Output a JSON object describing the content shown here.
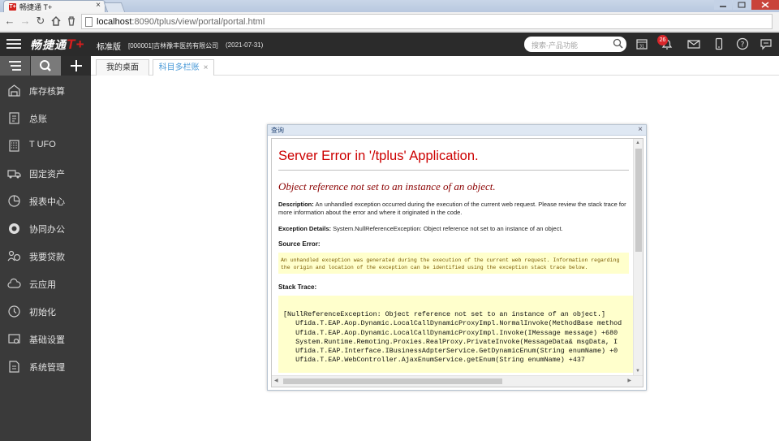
{
  "browser": {
    "tab_title": "畅捷通 T+",
    "tab_favicon": "T+",
    "url_host": "localhost",
    "url_rest": ":8090/tplus/view/portal/portal.html"
  },
  "header": {
    "logo_text": "畅捷通",
    "logo_mark": "T+",
    "edition": "标准版",
    "company": "[000001]吉林豫丰医药有限公司",
    "period": "(2021-07-31)",
    "search_placeholder": "搜索-产品功能",
    "notification_count": "26",
    "accent_color": "#d81e1e"
  },
  "sidebar": {
    "items": [
      {
        "label": "库存核算",
        "icon": "warehouse-icon"
      },
      {
        "label": "总账",
        "icon": "ledger-icon"
      },
      {
        "label": "T UFO",
        "icon": "report-sheet-icon"
      },
      {
        "label": "固定资产",
        "icon": "truck-icon"
      },
      {
        "label": "报表中心",
        "icon": "pie-chart-icon"
      },
      {
        "label": "协同办公",
        "icon": "collaboration-icon"
      },
      {
        "label": "我要贷款",
        "icon": "loan-icon"
      },
      {
        "label": "云应用",
        "icon": "cloud-icon"
      },
      {
        "label": "初始化",
        "icon": "clock-icon"
      },
      {
        "label": "基础设置",
        "icon": "settings-icon"
      },
      {
        "label": "系统管理",
        "icon": "system-doc-icon"
      }
    ]
  },
  "tabs": [
    {
      "label": "我的桌面"
    },
    {
      "label": "科目多栏账",
      "close": "×"
    }
  ],
  "dialog": {
    "title": "查询",
    "close": "×",
    "error_title": "Server Error in '/tplus' Application.",
    "error_subtitle": "Object reference not set to an instance of an object.",
    "description_label": "Description:",
    "description_text": "An unhandled exception occurred during the execution of the current web request. Please review the stack trace for more information about the error and where it originated in the code.",
    "exception_label": "Exception Details:",
    "exception_text": "System.NullReferenceException: Object reference not set to an instance of an object.",
    "source_label": "Source Error:",
    "source_lines": [
      "An unhandled exception was generated during the execution of the current web request. Information regarding",
      "the origin and location of the exception can be identified using the exception stack trace below."
    ],
    "stack_label": "Stack Trace:",
    "stack_lines": [
      "[NullReferenceException: Object reference not set to an instance of an object.]",
      "   Ufida.T.EAP.Aop.Dynamic.LocalCallDynamicProxyImpl.NormalInvoke(MethodBase method",
      "   Ufida.T.EAP.Aop.Dynamic.LocalCallDynamicProxyImpl.Invoke(IMessage message) +680",
      "   System.Runtime.Remoting.Proxies.RealProxy.PrivateInvoke(MessageData& msgData, I",
      "   Ufida.T.EAP.Interface.IBusinessAdpterService.GetDynamicEnum(String enumName) +0",
      "   Ufida.T.EAP.WebController.AjaxEnumService.getEnum(String enumName) +437"
    ]
  }
}
